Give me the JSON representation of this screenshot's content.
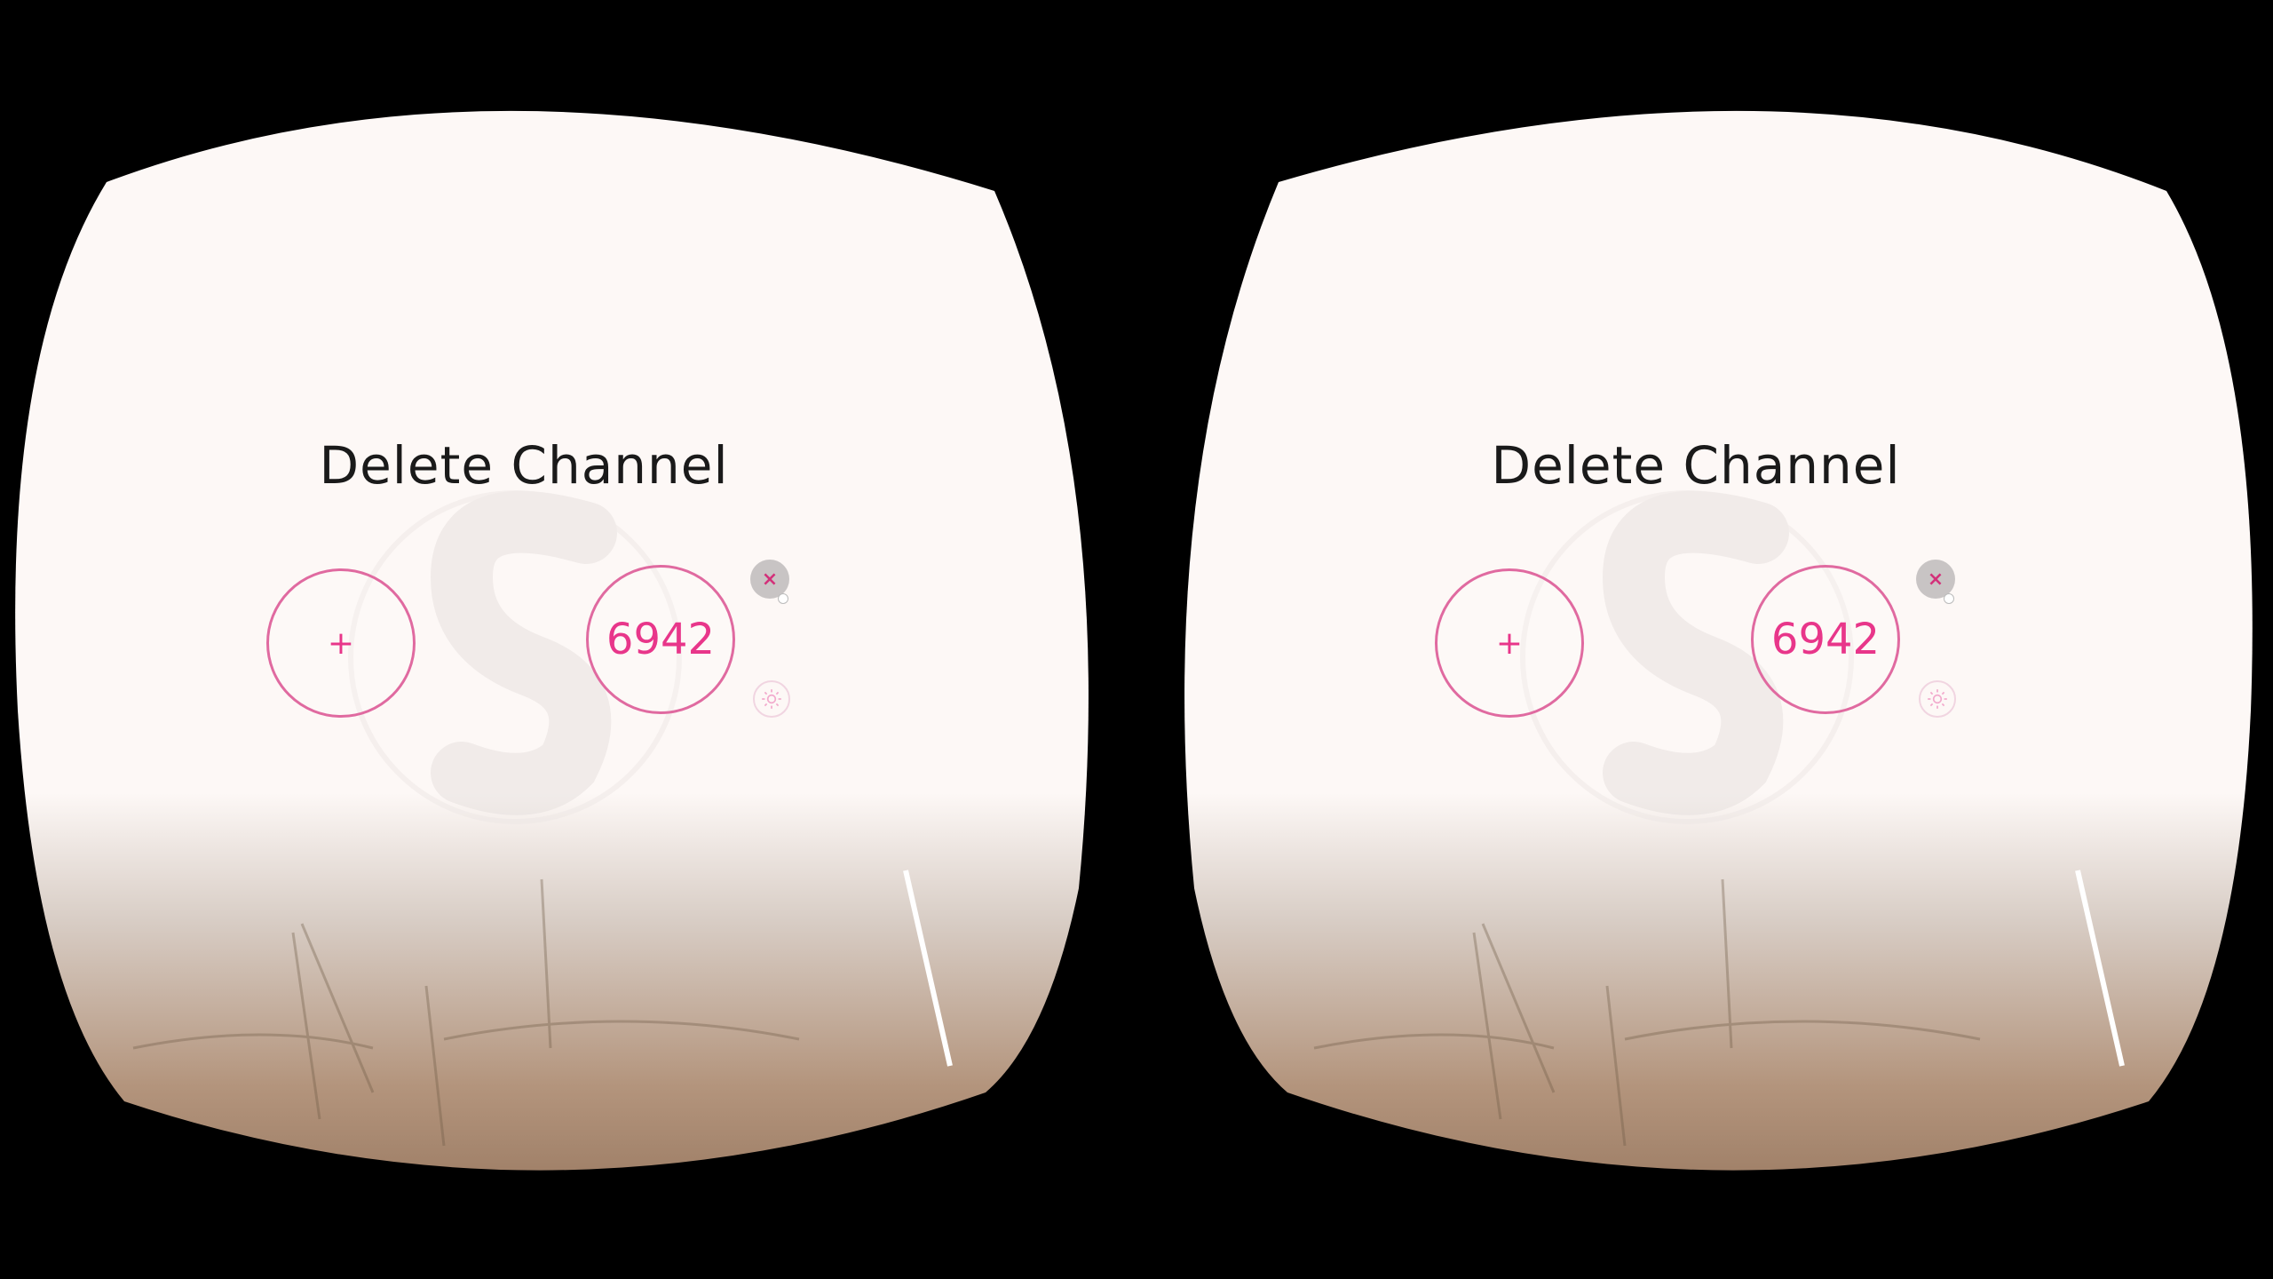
{
  "dialog": {
    "title": "Delete Channel",
    "add_label": "+",
    "channel_number": "6942",
    "close_label": "×"
  },
  "icons": {
    "close": "close-icon",
    "settings": "gear-icon",
    "logo": "s-logo-watermark"
  },
  "colors": {
    "accent": "#e8368a",
    "ring": "#e06aa0",
    "background": "#fdf8f6"
  }
}
